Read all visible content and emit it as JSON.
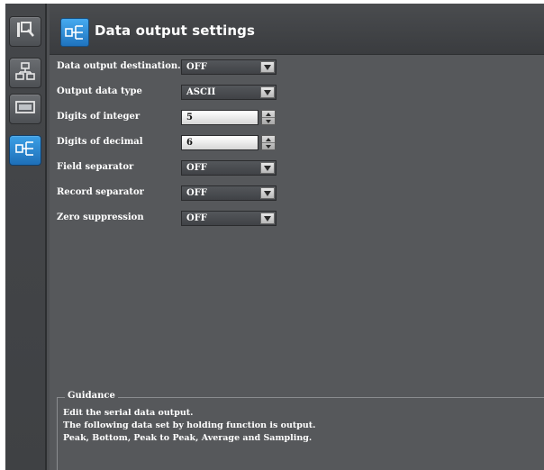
{
  "colors": {
    "accent": "#2a8ad6",
    "panel": "#56585b",
    "rail": "#414346"
  },
  "rail": {
    "items": [
      {
        "icon": "measure-icon",
        "active": false
      },
      {
        "icon": "network-icon",
        "active": false
      },
      {
        "icon": "display-icon",
        "active": false
      },
      {
        "icon": "data-output-icon",
        "active": true
      }
    ]
  },
  "header": {
    "icon": "data-output-icon",
    "title": "Data output settings"
  },
  "form": {
    "data_output_destination": {
      "label": "Data output destination.",
      "value": "OFF"
    },
    "output_data_type": {
      "label": "Output data type",
      "value": "ASCII"
    },
    "digits_of_integer": {
      "label": "Digits of integer",
      "value": "5"
    },
    "digits_of_decimal": {
      "label": "Digits of decimal",
      "value": "6"
    },
    "field_separator": {
      "label": "Field separator",
      "value": "OFF"
    },
    "record_separator": {
      "label": "Record separator",
      "value": "OFF"
    },
    "zero_suppression": {
      "label": "Zero suppression",
      "value": "OFF"
    }
  },
  "guidance": {
    "title": "Guidance",
    "lines": [
      "Edit the serial data output.",
      "The following data set by holding function is output.",
      "Peak, Bottom, Peak to Peak, Average and Sampling."
    ]
  }
}
